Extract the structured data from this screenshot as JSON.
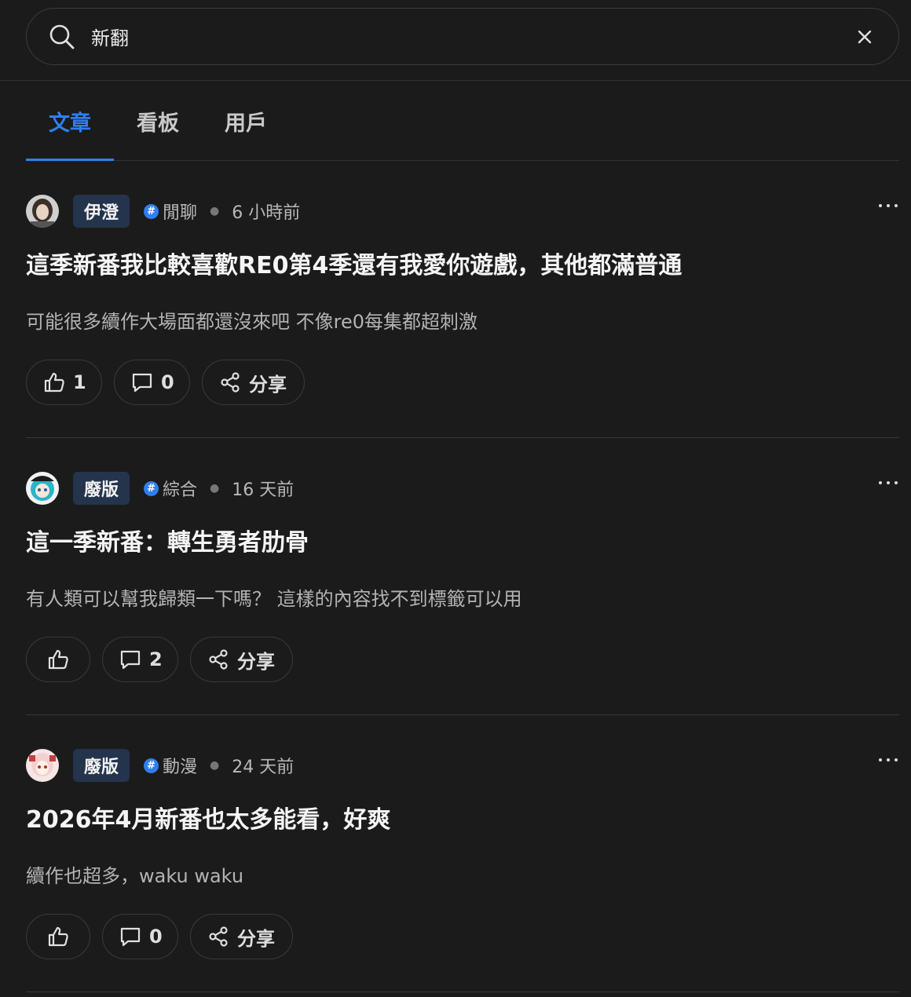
{
  "search": {
    "value": "新翻"
  },
  "tabs": [
    {
      "label": "文章",
      "active": true
    },
    {
      "label": "看板",
      "active": false
    },
    {
      "label": "用戶",
      "active": false
    }
  ],
  "colors": {
    "accent": "#2f7fef",
    "background": "#1b1b1b",
    "badge": "#24344d"
  },
  "posts": [
    {
      "author": "伊澄",
      "board": "閒聊",
      "time": "6 小時前",
      "title": "這季新番我比較喜歡RE0第4季還有我愛你遊戲，其他都滿普通",
      "excerpt": "可能很多續作大場面都還沒來吧 不像re0每集都超刺激",
      "likes": "1",
      "comments": "0",
      "share": "分享"
    },
    {
      "author": "廢版",
      "board": "綜合",
      "time": "16 天前",
      "title": "這一季新番：轉生勇者肋骨",
      "excerpt": "有人類可以幫我歸類一下嗎？ 這樣的內容找不到標籤可以用",
      "likes": "",
      "comments": "2",
      "share": "分享"
    },
    {
      "author": "廢版",
      "board": "動漫",
      "time": "24 天前",
      "title": "2026年4月新番也太多能看，好爽",
      "excerpt": "續作也超多，waku waku",
      "likes": "",
      "comments": "0",
      "share": "分享"
    }
  ]
}
